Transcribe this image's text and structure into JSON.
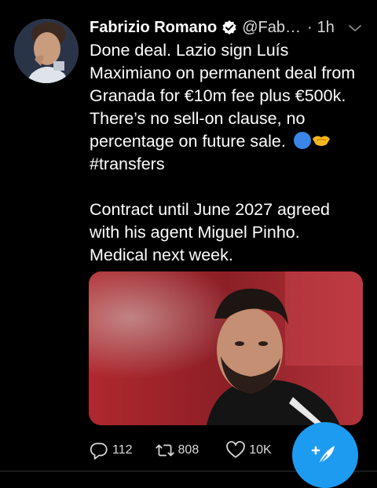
{
  "tweet": {
    "display_name": "Fabrizio Romano",
    "handle": "@Fab…",
    "separator": "·",
    "time": "1h",
    "text_line1": "Done deal. Lazio sign Luís",
    "text_line2": "Maximiano on permanent deal from",
    "text_line3": "Granada for €10m fee plus €500k.",
    "text_line4": "There’s no sell-on clause, no",
    "text_line5": "percentage on future sale.",
    "hashtag": "#transfers",
    "para2_line1": "Contract until June 2027 agreed",
    "para2_line2": "with his agent Miguel Pinho.",
    "para2_line3": "Medical next week."
  },
  "actions": {
    "reply_count": "112",
    "retweet_count": "808",
    "like_count": "10K"
  },
  "icons": {
    "verified": "verified-badge-icon",
    "caret": "chevron-down-icon",
    "reply": "reply-icon",
    "retweet": "retweet-icon",
    "like": "heart-icon",
    "compose": "compose-tweet-icon"
  },
  "colors": {
    "background": "#000000",
    "accent": "#1d9bf0",
    "secondary_text": "#d9d9d9"
  }
}
